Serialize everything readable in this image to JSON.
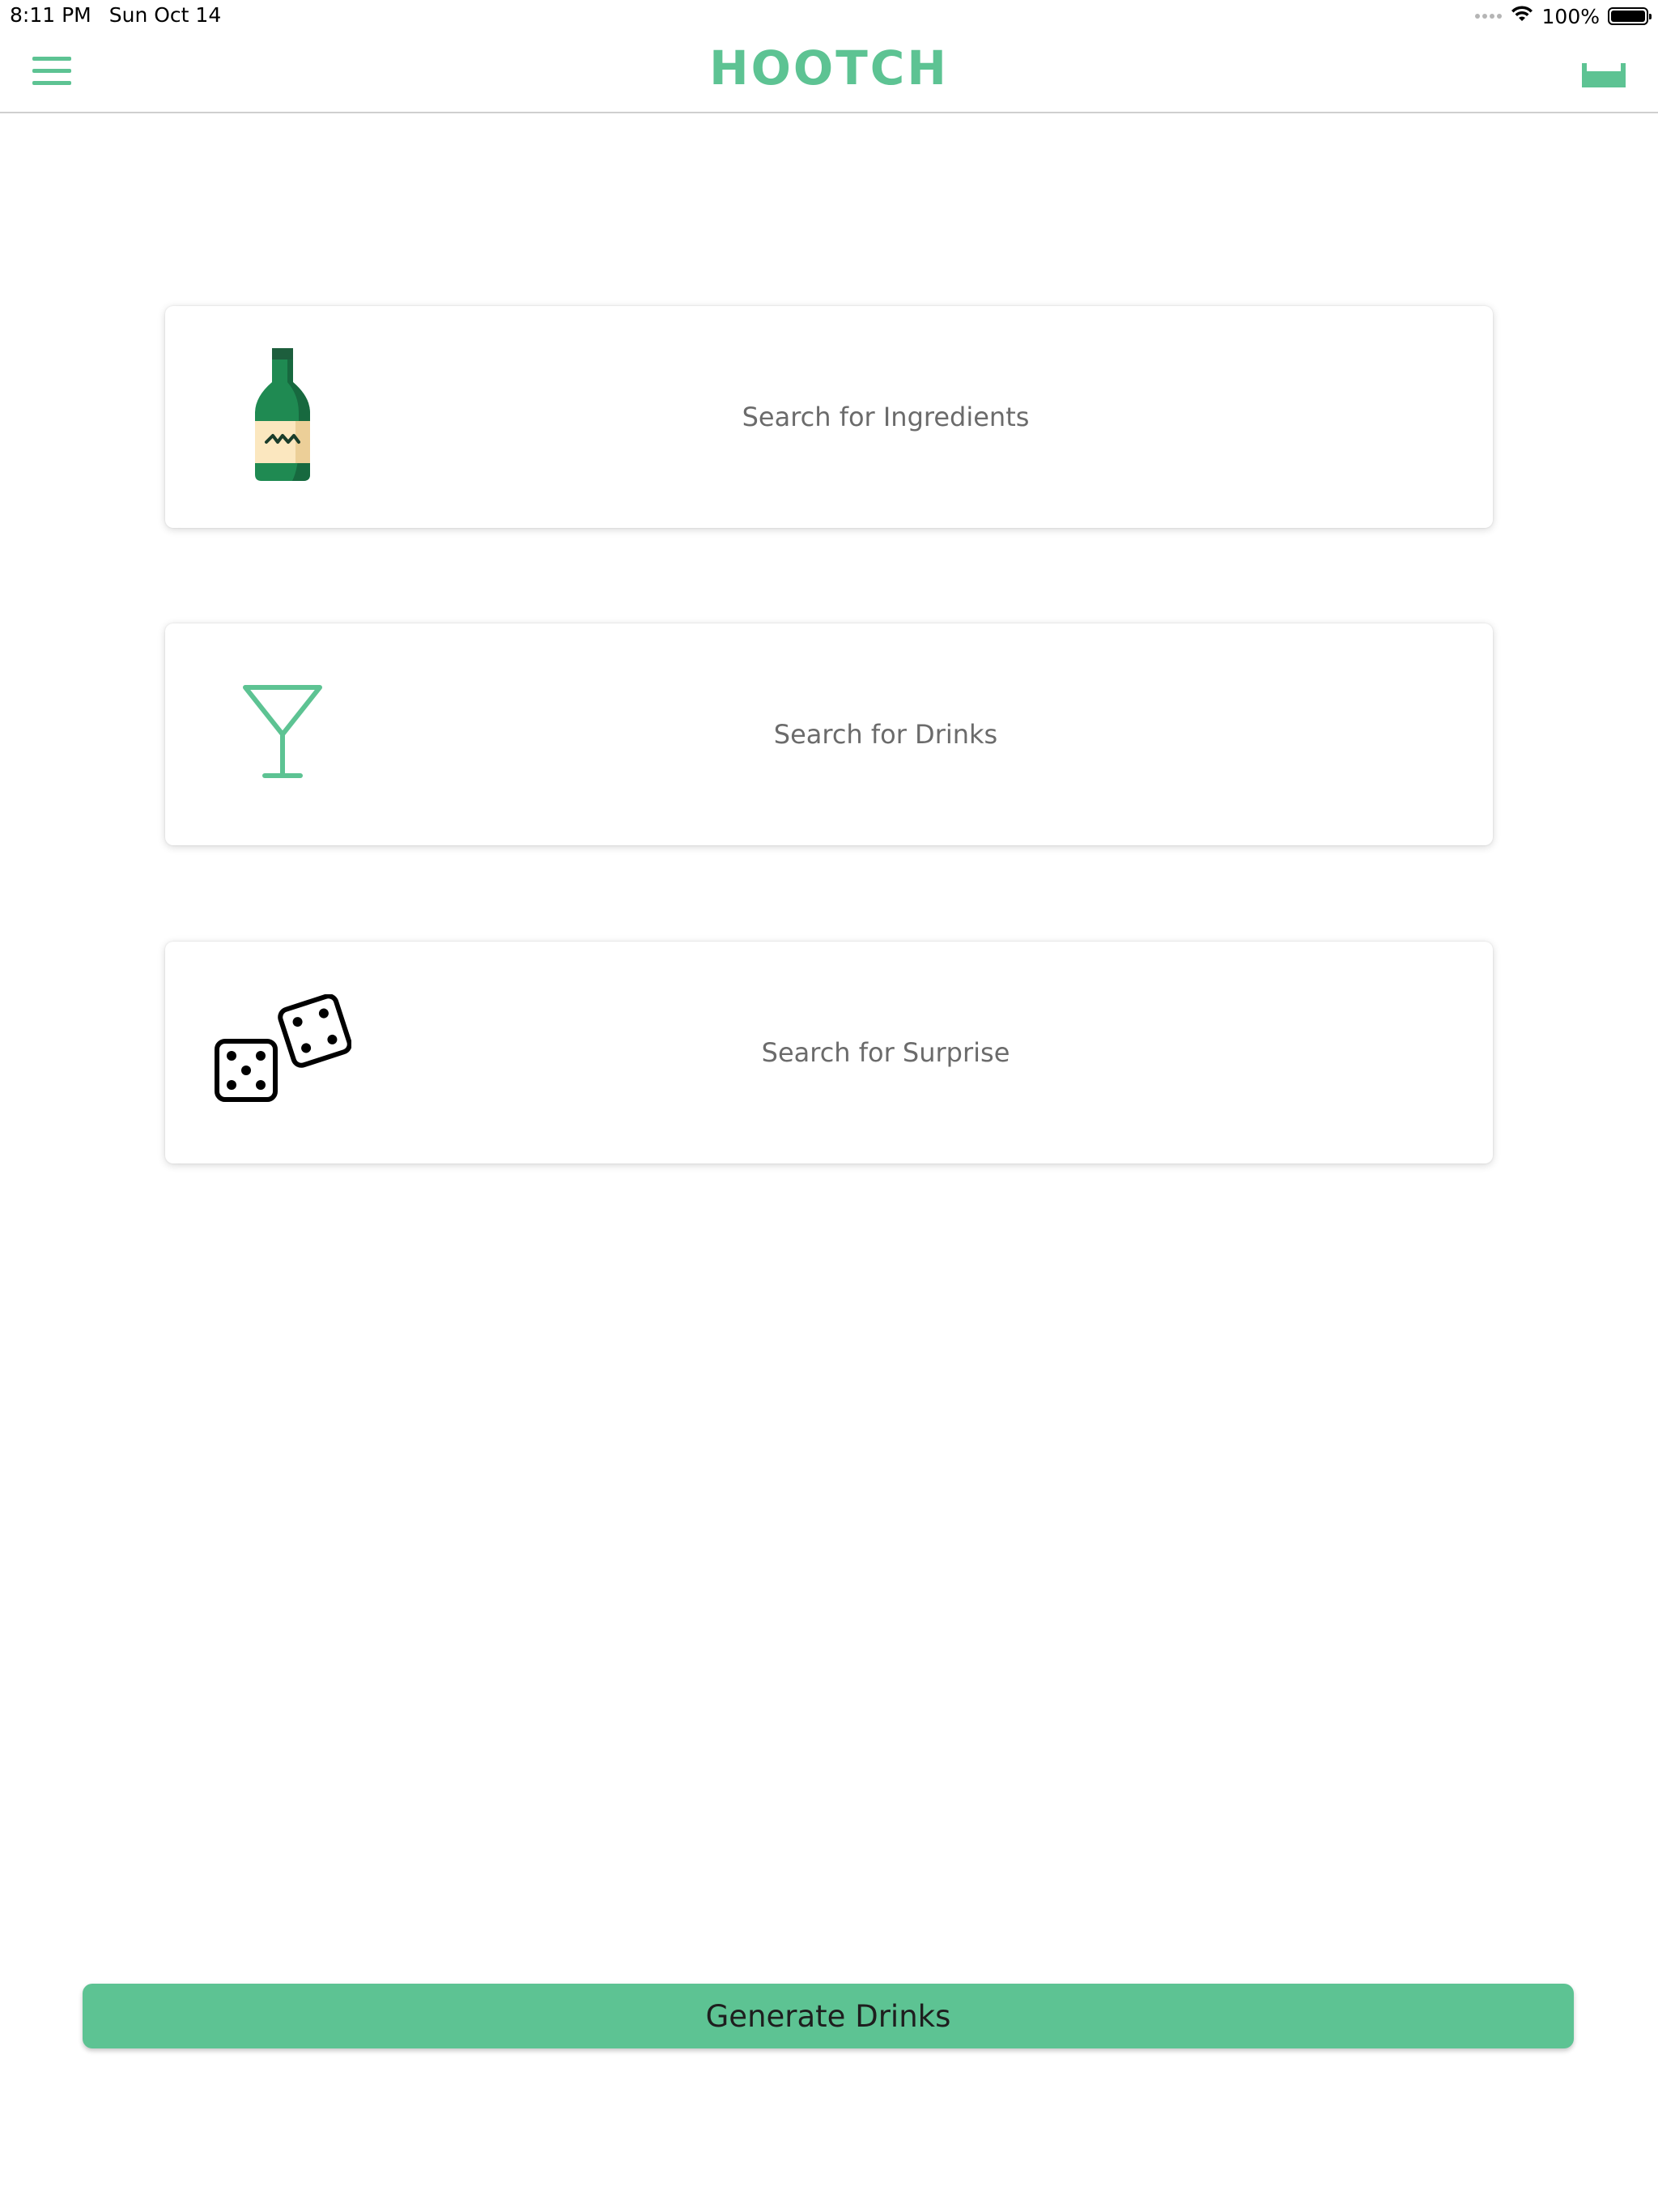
{
  "status_bar": {
    "time": "8:11 PM",
    "date": "Sun Oct 14",
    "battery": "100%",
    "battery_level": 1.0,
    "wifi_icon": "wifi-icon",
    "battery_icon": "battery-icon"
  },
  "nav": {
    "title": "HOOTCH",
    "menu_icon": "hamburger-menu-icon",
    "cart_icon": "cart-icon",
    "accent_color": "#5dc393"
  },
  "cards": [
    {
      "label": "Search for Ingredients",
      "icon": "bottle-icon"
    },
    {
      "label": "Search for Drinks",
      "icon": "martini-glass-icon"
    },
    {
      "label": "Search for Surprise",
      "icon": "dice-icon"
    }
  ],
  "generate_button": {
    "label": "Generate Drinks",
    "color": "#5dc393"
  }
}
